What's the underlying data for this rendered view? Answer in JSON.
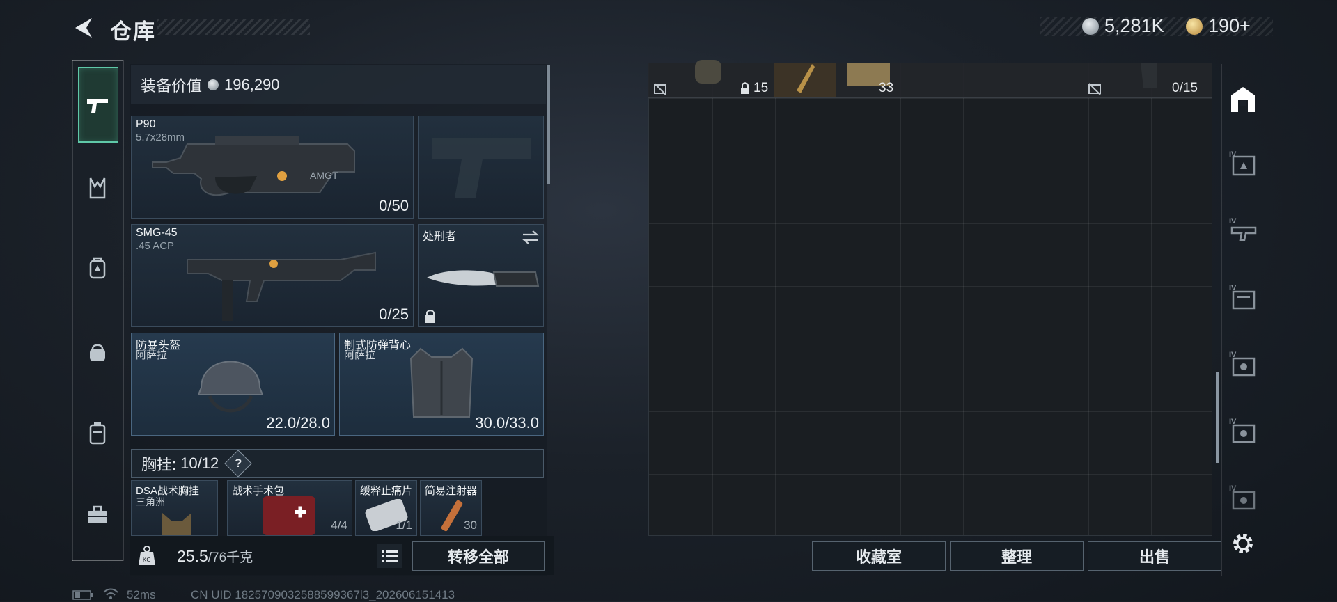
{
  "header": {
    "title": "仓库",
    "currency_silver": "5,281K",
    "currency_gold": "190+"
  },
  "left_nav": {
    "items": [
      "pistol-icon",
      "backpack-strap-icon",
      "armor-rig-icon",
      "bag-icon",
      "case-icon",
      "toolbox-icon"
    ],
    "active": "pistol-icon",
    "accent": "#5fc8a8"
  },
  "equipment": {
    "value_label": "装备价值",
    "value": "196,290",
    "slots": [
      {
        "name": "P90",
        "sub": "5.7x28mm",
        "count": "0/50"
      },
      {
        "name": "",
        "sub": "",
        "count": ""
      },
      {
        "name": "SMG-45",
        "sub": ".45 ACP",
        "count": "0/25"
      },
      {
        "name": "处刑者",
        "sub": "",
        "count": ""
      },
      {
        "name": "防暴头盔",
        "sub": "阿萨拉",
        "count": "22.0/28.0"
      },
      {
        "name": "制式防弹背心",
        "sub": "阿萨拉",
        "count": "30.0/33.0"
      }
    ],
    "vest_label": "胸挂:",
    "vest_count": "10/12",
    "help": "?",
    "small_slots": [
      {
        "name": "DSA战术胸挂",
        "sub": "三角洲",
        "count": ""
      },
      {
        "name": "战术手术包",
        "sub": "",
        "count": "4/4"
      },
      {
        "name": "缓释止痛片",
        "sub": "",
        "count": "1/1"
      },
      {
        "name": "简易注射器",
        "sub": "",
        "count": "30"
      }
    ]
  },
  "bottom_left": {
    "weight": "25.5",
    "weight_max": "/76千克",
    "transfer_label": "转移全部"
  },
  "storage": {
    "top_row": {
      "c1": "15",
      "c2": "33",
      "c3": "0/15"
    },
    "buttons": {
      "collection": "收藏室",
      "sort": "整理",
      "sell": "出售"
    }
  },
  "right_bar": {
    "items": [
      "home-icon",
      "tier-iv-icon",
      "tier-iv-icon",
      "tier-iv-icon",
      "tier-iv-icon",
      "tier-iv-icon",
      "tier-iv-icon"
    ],
    "tier_label": "IV"
  },
  "status": {
    "ping": "52ms",
    "uid": "CN UID 1825709032588599367l3_202606151413"
  }
}
